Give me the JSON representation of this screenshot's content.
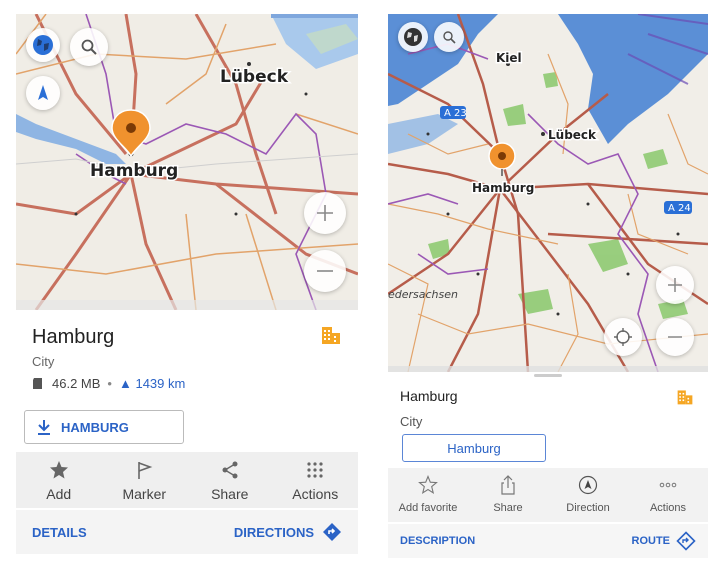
{
  "left": {
    "map": {
      "labels": {
        "lubeck": "Lübeck",
        "hamburg": "Hamburg"
      },
      "icons": [
        "globe-icon",
        "search-icon",
        "compass-icon",
        "location-pin-icon",
        "zoom-in-icon",
        "zoom-out-icon"
      ]
    },
    "place": {
      "name": "Hamburg",
      "type": "City",
      "size": "46.2 MB",
      "separator": "•",
      "distance": "▲ 1439 km",
      "category_icon": "city-buildings-icon",
      "category_color": "#f5a623"
    },
    "download_button": "HAMBURG",
    "toolbar": [
      {
        "label": "Add",
        "icon": "star-icon"
      },
      {
        "label": "Marker",
        "icon": "flag-icon"
      },
      {
        "label": "Share",
        "icon": "share-icon"
      },
      {
        "label": "Actions",
        "icon": "grid-dots-icon"
      }
    ],
    "bottom": {
      "details": "DETAILS",
      "directions": "DIRECTIONS"
    }
  },
  "right": {
    "map": {
      "labels": {
        "kiel": "Kiel",
        "lubeck": "Lübeck",
        "hamburg": "Hamburg",
        "a23": "A 23",
        "a24": "A 24",
        "niedersachsen": "edersachsen"
      }
    },
    "place": {
      "name": "Hamburg",
      "type": "City",
      "category_color": "#f5a623"
    },
    "city_button": "Hamburg",
    "toolbar": [
      {
        "label": "Add favorite",
        "icon": "star-outline-icon"
      },
      {
        "label": "Share",
        "icon": "share-box-icon"
      },
      {
        "label": "Direction",
        "icon": "navigate-icon"
      },
      {
        "label": "Actions",
        "icon": "more-dots-icon"
      }
    ],
    "bottom": {
      "description": "DESCRIPTION",
      "route": "ROUTE"
    }
  },
  "colors": {
    "accent": "#2b63c6",
    "pin": "#f0922e",
    "water": "#5b8fd6",
    "land": "#f2efe9"
  }
}
